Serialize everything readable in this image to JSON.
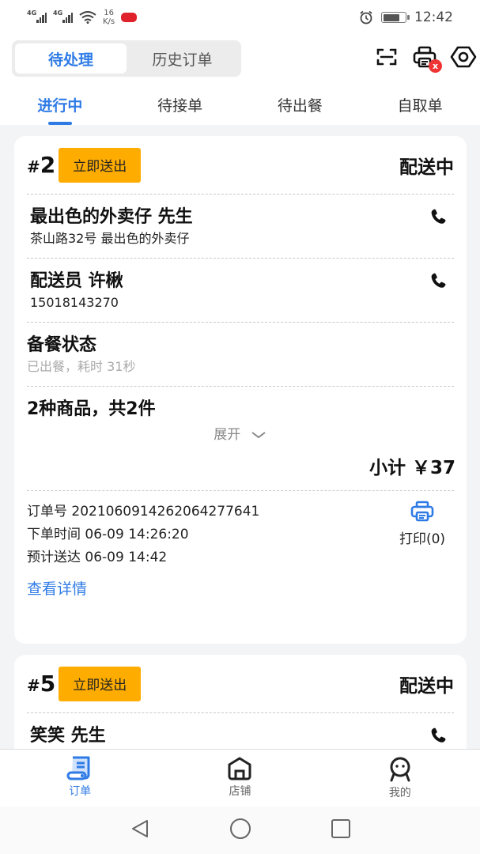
{
  "status_bar": {
    "network1": "4G",
    "network2": "4G",
    "speed_value": "16",
    "speed_unit": "K/s",
    "time": "12:42",
    "battery_percent": 75
  },
  "header": {
    "segments": [
      {
        "label": "待处理",
        "active": true
      },
      {
        "label": "历史订单",
        "active": false
      }
    ],
    "icons": [
      "scan-icon",
      "printer-icon",
      "eye-icon"
    ],
    "printer_badge": "x"
  },
  "tabs": [
    {
      "label": "进行中",
      "active": true
    },
    {
      "label": "待接单",
      "active": false
    },
    {
      "label": "待出餐",
      "active": false
    },
    {
      "label": "自取单",
      "active": false
    }
  ],
  "orders": [
    {
      "number_prefix": "#",
      "number": "2",
      "action_label": "立即送出",
      "status": "配送中",
      "customer_name": "最出色的外卖仔 先生",
      "customer_address": "茶山路32号 最出色的外卖仔",
      "rider_title": "配送员 许楸",
      "rider_phone": "15018143270",
      "prep_title": "备餐状态",
      "prep_status": "已出餐，耗时 31秒",
      "items_summary": "2种商品，共2件",
      "expand_label": "展开",
      "subtotal": "小计 ￥37",
      "order_no": "订单号 2021060914262064277641",
      "order_time": "下单时间 06-09 14:26:20",
      "eta": "预计送达 06-09 14:42",
      "detail_link": "查看详情",
      "print_label": "打印(0)"
    },
    {
      "number_prefix": "#",
      "number": "5",
      "action_label": "立即送出",
      "status": "配送中",
      "customer_name": "笑笑 先生"
    }
  ],
  "bottom_nav": [
    {
      "label": "订单",
      "icon": "orders-icon",
      "active": true
    },
    {
      "label": "店铺",
      "icon": "store-icon",
      "active": false
    },
    {
      "label": "我的",
      "icon": "profile-icon",
      "active": false
    }
  ],
  "colors": {
    "accent": "#2f7be6",
    "action_button": "#ffac00",
    "badge_red": "#ee3434"
  }
}
